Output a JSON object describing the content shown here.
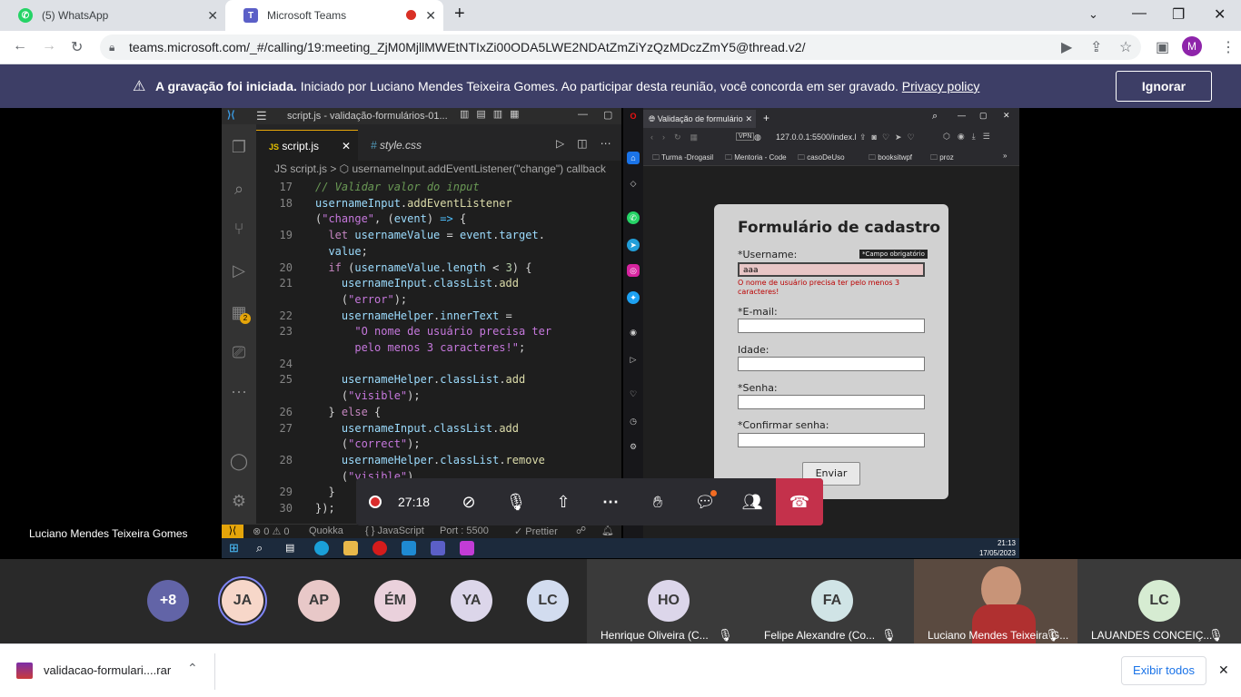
{
  "browser": {
    "tabs": [
      {
        "label": "(5) WhatsApp",
        "active": false,
        "icon": "whatsapp-icon"
      },
      {
        "label": "Microsoft Teams",
        "active": true,
        "icon": "teams-icon"
      }
    ],
    "url": "teams.microsoft.com/_#/calling/19:meeting_ZjM0MjllMWEtNTIxZi00ODA5LWE2NDAtZmZiYzQzMDczZmY5@thread.v2/",
    "profile_initial": "M"
  },
  "banner": {
    "bold": "A gravação foi iniciada.",
    "text": " Iniciado por Luciano Mendes Teixeira Gomes. Ao participar desta reunião, você concorda em ser gravado. ",
    "link": "Privacy policy",
    "ignore": "Ignorar"
  },
  "vscode": {
    "title": "script.js - validação-formulários-01...",
    "tabs": [
      "script.js",
      "style.css"
    ],
    "tab_prefix": "JS",
    "breadcrumb": "JS script.js > ⬡ usernameInput.addEventListener(\"change\") callback",
    "badge": "2",
    "status": {
      "errors": "0",
      "warnings": "0",
      "quokka": "Quokka",
      "language": "{ } JavaScript",
      "port": "Port : 5500",
      "prettier": "✓ Prettier"
    },
    "lines": [
      {
        "n": "17",
        "tokens": [
          {
            "c": "cm",
            "t": "// Validar valor do input"
          }
        ]
      },
      {
        "n": "18",
        "tokens": [
          {
            "c": "vr",
            "t": "usernameInput"
          },
          {
            "c": "pn",
            "t": "."
          },
          {
            "c": "fn",
            "t": "addEventListener"
          }
        ]
      },
      {
        "n": "",
        "tokens": [
          {
            "c": "pn",
            "t": "("
          },
          {
            "c": "str",
            "t": "\"change\""
          },
          {
            "c": "pn",
            "t": ", ("
          },
          {
            "c": "vr",
            "t": "event"
          },
          {
            "c": "pn",
            "t": ") "
          },
          {
            "c": "tp",
            "t": "=>"
          },
          {
            "c": "pn",
            "t": " {"
          }
        ]
      },
      {
        "n": "19",
        "tokens": [
          {
            "c": "kw",
            "t": "  let "
          },
          {
            "c": "vr",
            "t": "usernameValue"
          },
          {
            "c": "pn",
            "t": " = "
          },
          {
            "c": "vr",
            "t": "event"
          },
          {
            "c": "pn",
            "t": "."
          },
          {
            "c": "vr",
            "t": "target"
          },
          {
            "c": "pn",
            "t": "."
          }
        ]
      },
      {
        "n": "",
        "tokens": [
          {
            "c": "vr",
            "t": "  value"
          },
          {
            "c": "pn",
            "t": ";"
          }
        ]
      },
      {
        "n": "20",
        "tokens": [
          {
            "c": "kw",
            "t": "  if "
          },
          {
            "c": "pn",
            "t": "("
          },
          {
            "c": "vr",
            "t": "usernameValue"
          },
          {
            "c": "pn",
            "t": "."
          },
          {
            "c": "vr",
            "t": "length"
          },
          {
            "c": "pn",
            "t": " < "
          },
          {
            "c": "nu",
            "t": "3"
          },
          {
            "c": "pn",
            "t": ") {"
          }
        ]
      },
      {
        "n": "21",
        "tokens": [
          {
            "c": "vr",
            "t": "    usernameInput"
          },
          {
            "c": "pn",
            "t": "."
          },
          {
            "c": "vr",
            "t": "classList"
          },
          {
            "c": "pn",
            "t": "."
          },
          {
            "c": "fn",
            "t": "add"
          }
        ]
      },
      {
        "n": "",
        "tokens": [
          {
            "c": "pn",
            "t": "    ("
          },
          {
            "c": "str",
            "t": "\"error\""
          },
          {
            "c": "pn",
            "t": ");"
          }
        ]
      },
      {
        "n": "22",
        "tokens": [
          {
            "c": "vr",
            "t": "    usernameHelper"
          },
          {
            "c": "pn",
            "t": "."
          },
          {
            "c": "vr",
            "t": "innerText"
          },
          {
            "c": "pn",
            "t": " ="
          }
        ]
      },
      {
        "n": "23",
        "tokens": [
          {
            "c": "str",
            "t": "      \"O nome de usuário precisa ter"
          }
        ]
      },
      {
        "n": "",
        "tokens": [
          {
            "c": "str",
            "t": "      pelo menos 3 caracteres!\""
          },
          {
            "c": "pn",
            "t": ";"
          }
        ]
      },
      {
        "n": "24",
        "tokens": []
      },
      {
        "n": "25",
        "tokens": [
          {
            "c": "vr",
            "t": "    usernameHelper"
          },
          {
            "c": "pn",
            "t": "."
          },
          {
            "c": "vr",
            "t": "classList"
          },
          {
            "c": "pn",
            "t": "."
          },
          {
            "c": "fn",
            "t": "add"
          }
        ]
      },
      {
        "n": "",
        "tokens": [
          {
            "c": "pn",
            "t": "    ("
          },
          {
            "c": "str",
            "t": "\"visible\""
          },
          {
            "c": "pn",
            "t": ");"
          }
        ]
      },
      {
        "n": "26",
        "tokens": [
          {
            "c": "pn",
            "t": "  } "
          },
          {
            "c": "kw",
            "t": "else"
          },
          {
            "c": "pn",
            "t": " {"
          }
        ]
      },
      {
        "n": "27",
        "tokens": [
          {
            "c": "vr",
            "t": "    usernameInput"
          },
          {
            "c": "pn",
            "t": "."
          },
          {
            "c": "vr",
            "t": "classList"
          },
          {
            "c": "pn",
            "t": "."
          },
          {
            "c": "fn",
            "t": "add"
          }
        ]
      },
      {
        "n": "",
        "tokens": [
          {
            "c": "pn",
            "t": "    ("
          },
          {
            "c": "str",
            "t": "\"correct\""
          },
          {
            "c": "pn",
            "t": ");"
          }
        ]
      },
      {
        "n": "28",
        "tokens": [
          {
            "c": "vr",
            "t": "    usernameHelper"
          },
          {
            "c": "pn",
            "t": "."
          },
          {
            "c": "vr",
            "t": "classList"
          },
          {
            "c": "pn",
            "t": "."
          },
          {
            "c": "fn",
            "t": "remove"
          }
        ]
      },
      {
        "n": "",
        "tokens": [
          {
            "c": "pn",
            "t": "    ("
          },
          {
            "c": "str",
            "t": "\"visible\""
          },
          {
            "c": "pn",
            "t": ")"
          }
        ]
      },
      {
        "n": "29",
        "tokens": [
          {
            "c": "pn",
            "t": "  }"
          }
        ]
      },
      {
        "n": "30",
        "tokens": [
          {
            "c": "pn",
            "t": "});"
          }
        ]
      }
    ]
  },
  "mini_browser": {
    "tab_label": "Validação de formulário",
    "address": "127.0.0.1:5500/index.l",
    "bookmarks": [
      "Turma -Drogasil",
      "Mentoria - Code",
      "casoDeUso",
      "booksitwpf",
      "proz"
    ],
    "clock_time": "21:13",
    "clock_date": "17/05/2023"
  },
  "form": {
    "title": "Formulário de cadastro",
    "username_label": "*Username:",
    "username_value": "aaa",
    "required_tip": "*Campo obrigatório",
    "error": "O nome de usuário precisa ter pelo menos 3 caracteres!",
    "email_label": "*E-mail:",
    "age_label": "Idade:",
    "password_label": "*Senha:",
    "confirm_label": "*Confirmar senha:",
    "submit": "Enviar"
  },
  "meeting": {
    "timer": "27:18",
    "presenter": "Luciano Mendes Teixeira Gomes",
    "colors": {
      "leave": "#c4314b",
      "accent": "#6264a7"
    }
  },
  "participants": {
    "more": "+8",
    "avatars": [
      {
        "initials": "JA",
        "color": "#f7d7c9"
      },
      {
        "initials": "AP",
        "color": "#e8c8c8"
      },
      {
        "initials": "ÉM",
        "color": "#ead1dc"
      },
      {
        "initials": "YA",
        "color": "#dcd6ea"
      },
      {
        "initials": "LC",
        "color": "#d2dcef"
      }
    ],
    "tiles": [
      {
        "initials": "HO",
        "name": "Henrique Oliveira (C...",
        "color": "#dcd6ea"
      },
      {
        "initials": "FA",
        "name": "Felipe Alexandre (Co...",
        "color": "#d0e4e6"
      },
      {
        "initials": "",
        "name": "Luciano Mendes Teixeira G...",
        "color": "#5a4a40"
      },
      {
        "initials": "LC",
        "name": "LAUANDES CONCEIÇ...",
        "color": "#d6ecd2"
      }
    ]
  },
  "download": {
    "file": "validacao-formulari....rar",
    "show_all": "Exibir todos"
  }
}
